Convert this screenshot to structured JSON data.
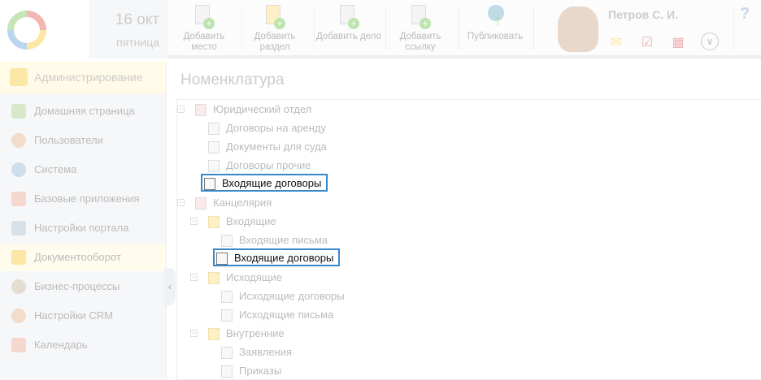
{
  "header": {
    "date_day": "16 окт",
    "date_weekday": "пятница",
    "toolbar": [
      {
        "label": "Добавить место"
      },
      {
        "label": "Добавить раздел"
      },
      {
        "label": "Добавить дело"
      },
      {
        "label": "Добавить ссылку"
      },
      {
        "label": "Публиковать"
      }
    ],
    "user_name": "Петров С. И.",
    "help": "?"
  },
  "sidebar": {
    "header": "Администрирование",
    "items": [
      {
        "label": "Домашняя страница"
      },
      {
        "label": "Пользователи"
      },
      {
        "label": "Система"
      },
      {
        "label": "Базовые приложения"
      },
      {
        "label": "Настройки портала"
      },
      {
        "label": "Документооборот"
      },
      {
        "label": "Бизнес-процессы"
      },
      {
        "label": "Настройки CRM"
      },
      {
        "label": "Календарь"
      }
    ]
  },
  "main": {
    "title": "Номенклатура",
    "tree": [
      {
        "label": "Юридический отдел"
      },
      {
        "label": "Договоры на аренду"
      },
      {
        "label": "Документы для суда"
      },
      {
        "label": "Договоры прочие"
      },
      {
        "label": "Входящие договоры"
      },
      {
        "label": "Канцелярия"
      },
      {
        "label": "Входящие"
      },
      {
        "label": "Входящие письма"
      },
      {
        "label": "Входящие договоры"
      },
      {
        "label": "Исходящие"
      },
      {
        "label": "Исходящие договоры"
      },
      {
        "label": "Исходящие письма"
      },
      {
        "label": "Внутренние"
      },
      {
        "label": "Заявления"
      },
      {
        "label": "Приказы"
      }
    ]
  }
}
